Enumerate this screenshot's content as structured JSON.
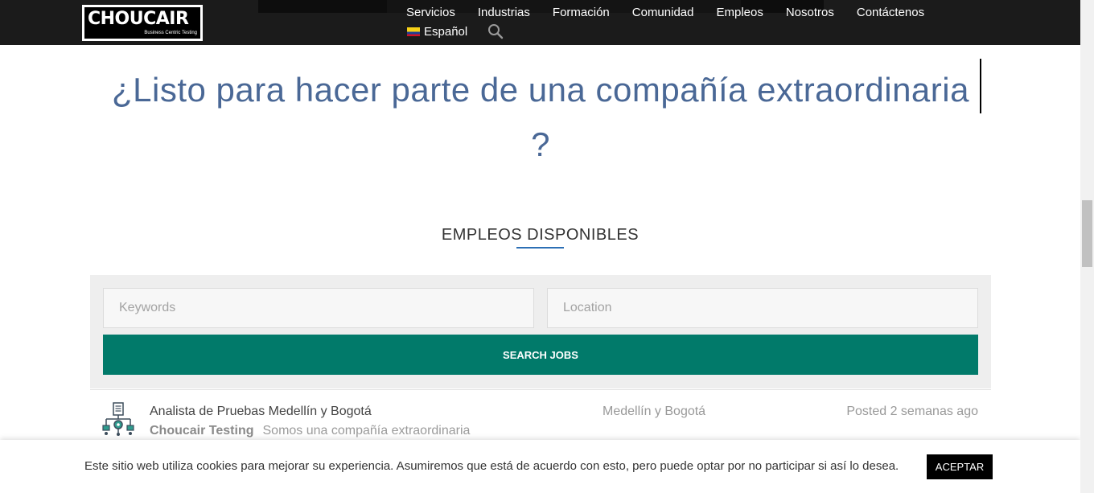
{
  "header": {
    "logo_text": "CHOUCAIR",
    "logo_tagline": "Business Centric Testing",
    "nav": [
      "Servicios",
      "Industrias",
      "Formación",
      "Comunidad",
      "Empleos",
      "Nosotros",
      "Contáctenos"
    ],
    "language": "Español",
    "language_flag": "colombia-flag-icon",
    "search_icon": "search-icon"
  },
  "hero": {
    "line1": "¿Listo para hacer parte de una compañía extraordinaria",
    "line2": "?"
  },
  "section": {
    "title": "EMPLEOS DISPONIBLES"
  },
  "search": {
    "keywords_placeholder": "Keywords",
    "location_placeholder": "Location",
    "button_label": "SEARCH JOBS"
  },
  "jobs": [
    {
      "title": "Analista de Pruebas Medellín y Bogotá",
      "company": "Choucair Testing",
      "tagline": "Somos una compañía extraordinaria",
      "location": "Medellín y Bogotá",
      "posted": "Posted 2 semanas ago"
    }
  ],
  "cookie": {
    "text": "Este sitio web utiliza cookies para mejorar su experiencia. Asumiremos que está de acuerdo con esto, pero puede optar por no participar si así lo desea.",
    "accept_label": "ACEPTAR"
  },
  "colors": {
    "header_bg": "#1b1b1b",
    "hero_text": "#4a6896",
    "button_green": "#017a6a",
    "underline_blue": "#2c6fb5"
  }
}
